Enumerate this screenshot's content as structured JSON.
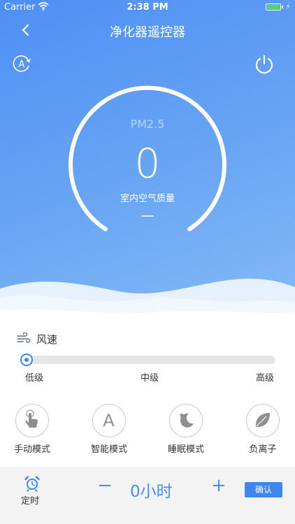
{
  "status_bar": {
    "carrier": "Carrier",
    "time": "2:38 PM"
  },
  "nav": {
    "title": "净化器遥控器",
    "back_icon": "chevron-left-icon"
  },
  "header_icons": {
    "auto": "auto-mode-icon",
    "power": "power-icon"
  },
  "air_quality": {
    "metric": "PM2.5",
    "value": "0",
    "caption": "室内空气质量",
    "level": "—"
  },
  "wind_speed": {
    "label": "风速",
    "levels": [
      "低级",
      "中级",
      "高级"
    ],
    "current_fraction": 0
  },
  "modes": [
    {
      "label": "手动模式",
      "icon": "hand-tap-icon"
    },
    {
      "label": "智能模式",
      "icon": "letter-a-icon"
    },
    {
      "label": "睡眠模式",
      "icon": "moon-star-icon"
    },
    {
      "label": "负离子",
      "icon": "leaf-icon"
    }
  ],
  "timer": {
    "label": "定时",
    "minus": "−",
    "value": "0小时",
    "plus": "+",
    "confirm": "确认"
  },
  "colors": {
    "accent": "#3f86f0",
    "hero_start": "#4e8ff5",
    "hero_end": "#86bbf6",
    "bottom_bar": "#f3f3f3"
  }
}
